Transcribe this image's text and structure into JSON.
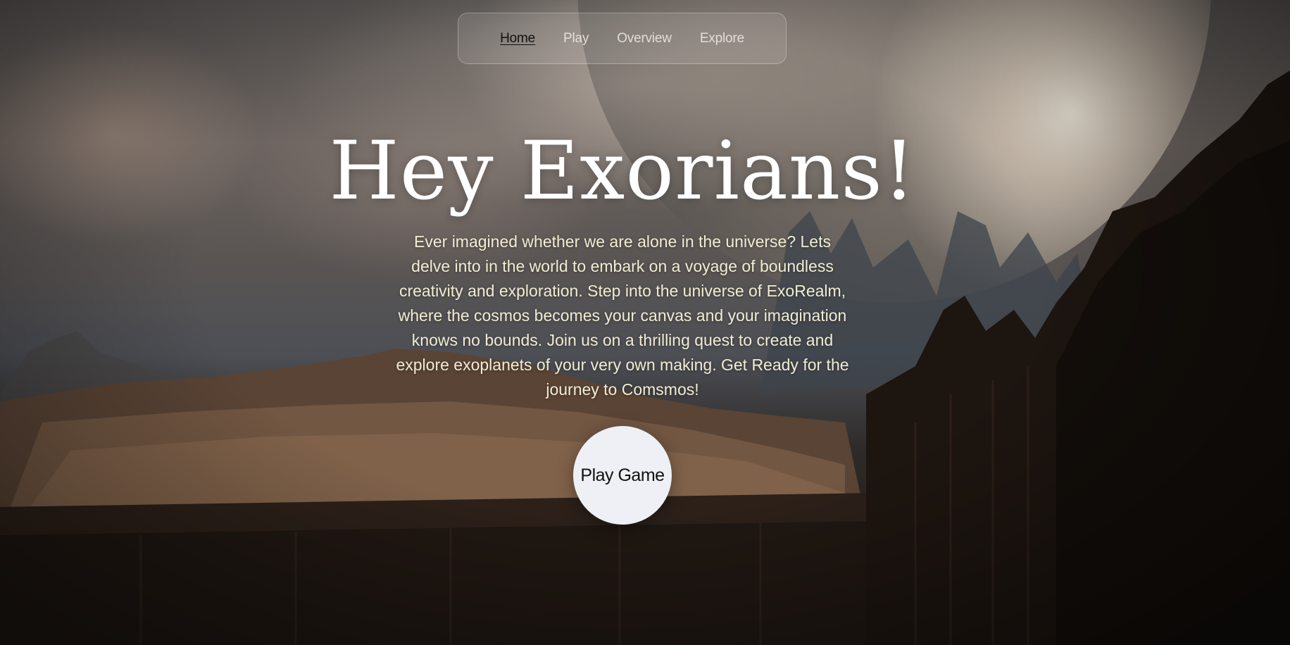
{
  "nav": {
    "items": [
      {
        "label": "Home",
        "active": true
      },
      {
        "label": "Play",
        "active": false
      },
      {
        "label": "Overview",
        "active": false
      },
      {
        "label": "Explore",
        "active": false
      }
    ]
  },
  "hero": {
    "title": "Hey Exorians!",
    "description": "Ever imagined whether we are alone in the universe? Lets delve into in the world to embark on a voyage of boundless creativity and exploration. Step into the universe of ExoRealm, where the cosmos becomes your canvas and your imagination knows no bounds. Join us on a thrilling quest to create and explore exoplanets of your very own making. Get Ready for the journey to Comsmos!",
    "cta_label": "Play Game"
  },
  "colors": {
    "text_primary": "#ffffff",
    "text_body": "#f1ecd2",
    "button_bg": "#eef0f5",
    "nav_active": "#111111"
  }
}
